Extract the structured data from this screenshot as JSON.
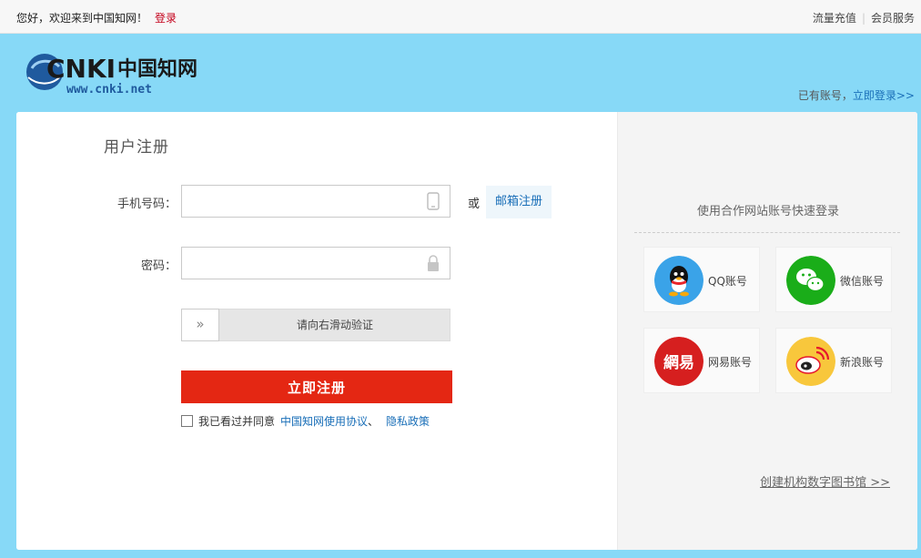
{
  "topbar": {
    "welcome": "您好，欢迎来到中国知网！",
    "login": "登录",
    "recharge": "流量充值",
    "member": "会员服务"
  },
  "logo": {
    "brand": "CNKI",
    "cn_name": "中国知网",
    "url": "www.cnki.net"
  },
  "header": {
    "have_account": "已有账号，",
    "login_now": "立即登录>>"
  },
  "form": {
    "title": "用户注册",
    "phone_label": "手机号码：",
    "phone_value": "",
    "or": "或",
    "email_register": "邮箱注册",
    "password_label": "密码：",
    "password_value": "",
    "slider_hint": "请向右滑动验证",
    "slider_handle": "»",
    "submit": "立即注册",
    "agree_text": "我已看过并同意",
    "terms_link": "中国知网使用协议",
    "dun": "、",
    "privacy_link": "隐私政策"
  },
  "partner": {
    "title": "使用合作网站账号快速登录",
    "items": [
      {
        "label": "QQ账号",
        "icon": "qq-icon",
        "color": "#3aa3e8"
      },
      {
        "label": "微信账号",
        "icon": "wechat-icon",
        "color": "#1aad19"
      },
      {
        "label": "网易账号",
        "icon": "netease-icon",
        "color": "#d61f1f"
      },
      {
        "label": "新浪账号",
        "icon": "weibo-icon",
        "color": "#f8c73c"
      }
    ],
    "netease_glyph": "網易",
    "create_library": "创建机构数字图书馆 >>"
  }
}
